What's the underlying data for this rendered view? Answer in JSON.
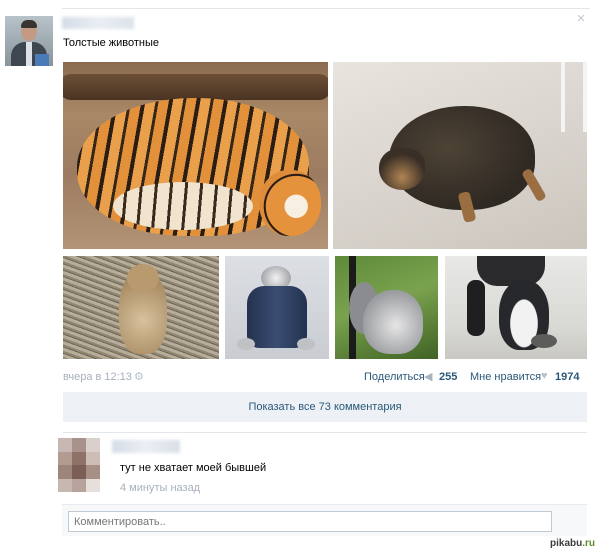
{
  "post": {
    "title": "Толстые животные",
    "close_icon": "×",
    "photos": [
      {
        "name": "tiger"
      },
      {
        "name": "dog"
      },
      {
        "name": "prairie-dog"
      },
      {
        "name": "cat-in-jeans"
      },
      {
        "name": "squirrel"
      },
      {
        "name": "penguin"
      }
    ],
    "time": "вчера в 12:13",
    "share_label": "Поделиться",
    "share_count": "255",
    "like_label": "Мне нравится",
    "like_count": "1974",
    "icons": {
      "settings": "gear-icon",
      "share": "megaphone-icon",
      "like": "heart-icon"
    }
  },
  "comments": {
    "show_all_label": "Показать все 73 комментария",
    "items": [
      {
        "text": "тут не хватает моей бывшей",
        "time": "4 минуты назад"
      }
    ],
    "input_placeholder": "Комментировать.."
  },
  "watermark": {
    "text_main": "pikabu",
    "text_dot": ".ru"
  },
  "colors": {
    "link": "#2b587a",
    "muted": "#a8b0ba",
    "button_bg": "#edf1f5"
  }
}
